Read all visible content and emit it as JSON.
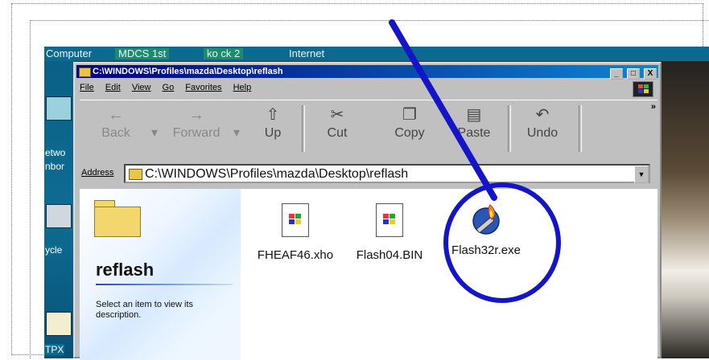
{
  "desktop": {
    "taskbar_labels": [
      "Computer",
      "MDCS 1st",
      "ko ck 2",
      "Internet"
    ],
    "icon_labels": [
      "etwo",
      "nbor",
      "ycle",
      "TPX"
    ]
  },
  "window": {
    "title": "C:\\WINDOWS\\Profiles\\mazda\\Desktop\\reflash",
    "controls": [
      "_",
      "□",
      "X"
    ]
  },
  "menu": [
    "File",
    "Edit",
    "View",
    "Go",
    "Favorites",
    "Help"
  ],
  "toolbar": {
    "back": "Back",
    "forward": "Forward",
    "up": "Up",
    "cut": "Cut",
    "copy": "Copy",
    "paste": "Paste",
    "undo": "Undo",
    "overflow": "»"
  },
  "address": {
    "label": "Address",
    "value": "C:\\WINDOWS\\Profiles\\mazda\\Desktop\\reflash"
  },
  "left_panel": {
    "folder_name": "reflash",
    "description": "Select an item to view its description."
  },
  "files": [
    {
      "name": "FHEAF46.xho",
      "icon": "windows-file-icon"
    },
    {
      "name": "Flash04.BIN",
      "icon": "windows-file-icon"
    },
    {
      "name": "Flash32r.exe",
      "icon": "torch-exe-icon"
    }
  ],
  "annotation": {
    "color": "#1414c8"
  }
}
